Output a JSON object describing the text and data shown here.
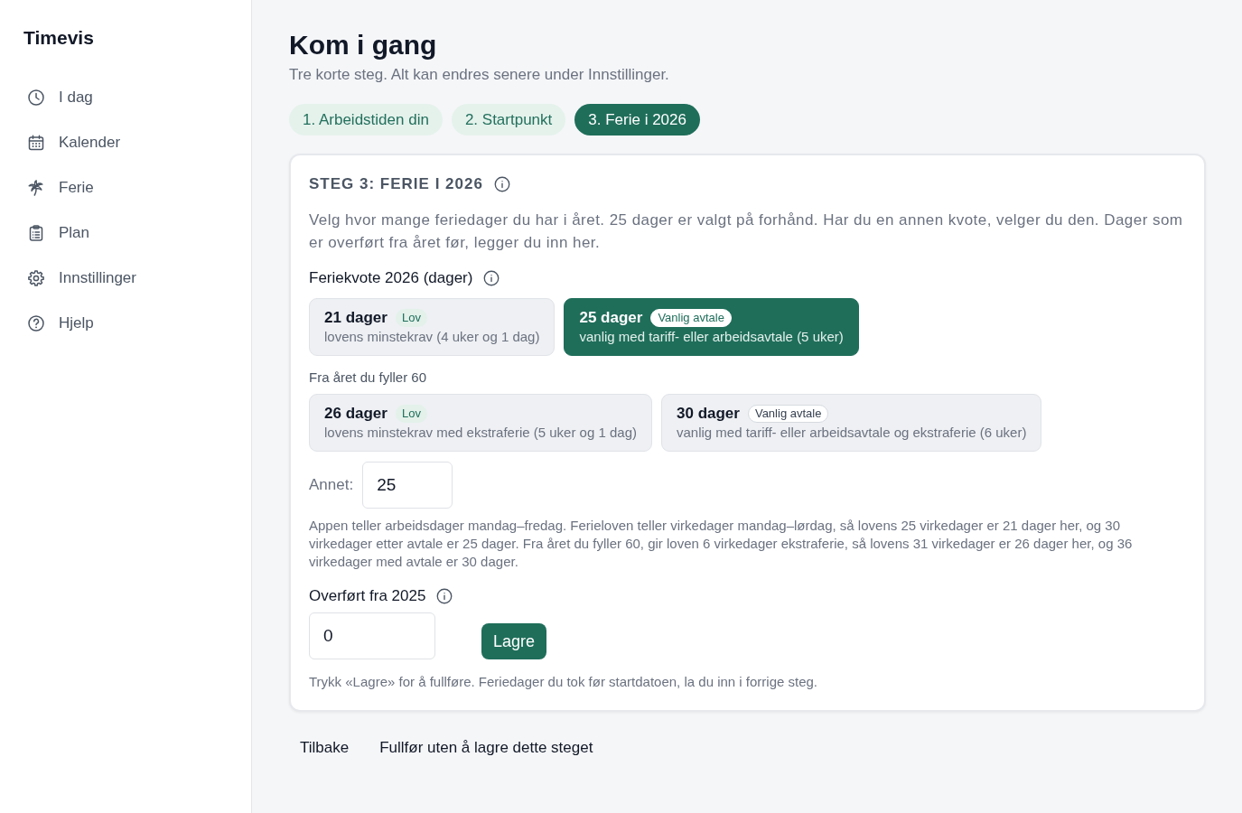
{
  "sidebar": {
    "brand": "Timevis",
    "items": [
      {
        "label": "I dag"
      },
      {
        "label": "Kalender"
      },
      {
        "label": "Ferie"
      },
      {
        "label": "Plan"
      },
      {
        "label": "Innstillinger"
      },
      {
        "label": "Hjelp"
      }
    ]
  },
  "page": {
    "title": "Kom i gang",
    "subtitle": "Tre korte steg. Alt kan endres senere under Innstillinger."
  },
  "steps": [
    {
      "label": "1. Arbeidstiden din",
      "selected": false
    },
    {
      "label": "2. Startpunkt",
      "selected": false
    },
    {
      "label": "3. Ferie i 2026",
      "selected": true
    }
  ],
  "card": {
    "heading": "STEG 3: FERIE I 2026",
    "intro": "Velg hvor mange feriedager du har i året. 25 dager er valgt på forhånd. Har du en annen kvote, velger du den. Dager som er overført fra året før, legger du inn her.",
    "quota_label": "Feriekvote 2026 (dager)",
    "options": [
      {
        "title": "21 dager",
        "tag": {
          "label": "Lov",
          "kind": "law"
        },
        "description": "lovens minstekrav (4 uker og 1 dag)",
        "selected": false
      },
      {
        "title": "25 dager",
        "tag": {
          "label": "Vanlig avtale",
          "kind": "agreement"
        },
        "description": "vanlig med tariff- eller arbeidsavtale (5 uker)",
        "selected": true
      }
    ],
    "over_60_label": "Fra året du fyller 60",
    "over_60_options": [
      {
        "title": "26 dager",
        "tag": {
          "label": "Lov",
          "kind": "law"
        },
        "description": "lovens minstekrav med ekstraferie (5 uker og 1 dag)",
        "selected": false
      },
      {
        "title": "30 dager",
        "tag": {
          "label": "Vanlig avtale",
          "kind": "agreement"
        },
        "description": "vanlig med tariff- eller arbeidsavtale og ekstraferie (6 uker)",
        "selected": false
      }
    ],
    "other_label": "Annet:",
    "other_value": "25",
    "note": "Appen teller arbeidsdager mandag–fredag. Ferieloven teller virkedager mandag–lørdag, så lovens 25 virkedager er 21 dager her, og 30 virkedager etter avtale er 25 dager. Fra året du fyller 60, gir loven 6 virkedager ekstraferie, så lovens 31 virkedager er 26 dager her, og 36 virkedager med avtale er 30 dager.",
    "carried_label": "Overført fra 2025",
    "carried_value": "0",
    "save_button": "Lagre",
    "hint": "Trykk «Lagre» for å fullføre. Feriedager du tok før startdatoen, la du inn i forrige steg."
  },
  "footer_buttons": [
    "Tilbake",
    "Fullfør uten å lagre dette steget"
  ]
}
